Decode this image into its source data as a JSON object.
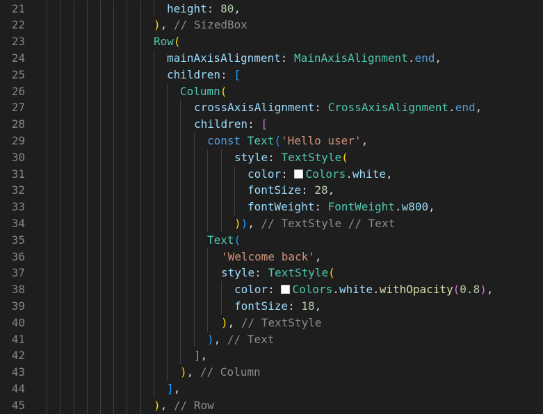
{
  "editor": {
    "line_numbers": [
      "21",
      "22",
      "23",
      "24",
      "25",
      "26",
      "27",
      "28",
      "29",
      "30",
      "31",
      "32",
      "33",
      "34",
      "35",
      "36",
      "37",
      "38",
      "39",
      "40",
      "41",
      "42",
      "43",
      "44",
      "45"
    ],
    "lines": [
      {
        "indent": 240,
        "tokens": [
          {
            "t": "height",
            "c": "prop"
          },
          {
            "t": ": ",
            "c": "p"
          },
          {
            "t": "80",
            "c": "num"
          },
          {
            "t": ",",
            "c": "p"
          }
        ]
      },
      {
        "indent": 221,
        "tokens": [
          {
            "t": ")",
            "c": "b3"
          },
          {
            "t": ", ",
            "c": "p"
          },
          {
            "t": "// SizedBox",
            "c": "cmt"
          }
        ]
      },
      {
        "indent": 221,
        "tokens": [
          {
            "t": "Row",
            "c": "cls"
          },
          {
            "t": "(",
            "c": "b3"
          }
        ]
      },
      {
        "indent": 240,
        "tokens": [
          {
            "t": "mainAxisAlignment",
            "c": "prop"
          },
          {
            "t": ": ",
            "c": "p"
          },
          {
            "t": "MainAxisAlignment",
            "c": "cls"
          },
          {
            "t": ".",
            "c": "p"
          },
          {
            "t": "end",
            "c": "kw"
          },
          {
            "t": ",",
            "c": "p"
          }
        ]
      },
      {
        "indent": 240,
        "tokens": [
          {
            "t": "children",
            "c": "prop"
          },
          {
            "t": ": ",
            "c": "p"
          },
          {
            "t": "[",
            "c": "b2"
          }
        ]
      },
      {
        "indent": 259,
        "tokens": [
          {
            "t": "Column",
            "c": "cls"
          },
          {
            "t": "(",
            "c": "b3"
          }
        ]
      },
      {
        "indent": 279,
        "tokens": [
          {
            "t": "crossAxisAlignment",
            "c": "prop"
          },
          {
            "t": ": ",
            "c": "p"
          },
          {
            "t": "CrossAxisAlignment",
            "c": "cls"
          },
          {
            "t": ".",
            "c": "p"
          },
          {
            "t": "end",
            "c": "kw"
          },
          {
            "t": ",",
            "c": "p"
          }
        ]
      },
      {
        "indent": 279,
        "tokens": [
          {
            "t": "children",
            "c": "prop"
          },
          {
            "t": ": ",
            "c": "p"
          },
          {
            "t": "[",
            "c": "b1"
          }
        ]
      },
      {
        "indent": 298,
        "tokens": [
          {
            "t": "const ",
            "c": "kw"
          },
          {
            "t": "Text",
            "c": "cls"
          },
          {
            "t": "(",
            "c": "b2"
          },
          {
            "t": "'Hello user'",
            "c": "str"
          },
          {
            "t": ",",
            "c": "p"
          }
        ]
      },
      {
        "indent": 337,
        "tokens": [
          {
            "t": "style",
            "c": "prop"
          },
          {
            "t": ": ",
            "c": "p"
          },
          {
            "t": "TextStyle",
            "c": "cls"
          },
          {
            "t": "(",
            "c": "b3"
          }
        ]
      },
      {
        "indent": 356,
        "tokens": [
          {
            "t": "color",
            "c": "prop"
          },
          {
            "t": ": ",
            "c": "p"
          },
          {
            "t": "",
            "c": "swatch"
          },
          {
            "t": "Colors",
            "c": "cls"
          },
          {
            "t": ".",
            "c": "p"
          },
          {
            "t": "white",
            "c": "prop"
          },
          {
            "t": ",",
            "c": "p"
          }
        ]
      },
      {
        "indent": 356,
        "tokens": [
          {
            "t": "fontSize",
            "c": "prop"
          },
          {
            "t": ": ",
            "c": "p"
          },
          {
            "t": "28",
            "c": "num"
          },
          {
            "t": ",",
            "c": "p"
          }
        ]
      },
      {
        "indent": 356,
        "tokens": [
          {
            "t": "fontWeight",
            "c": "prop"
          },
          {
            "t": ": ",
            "c": "p"
          },
          {
            "t": "FontWeight",
            "c": "cls"
          },
          {
            "t": ".",
            "c": "p"
          },
          {
            "t": "w800",
            "c": "prop"
          },
          {
            "t": ",",
            "c": "p"
          }
        ]
      },
      {
        "indent": 337,
        "tokens": [
          {
            "t": ")",
            "c": "b3"
          },
          {
            "t": ")",
            "c": "b2"
          },
          {
            "t": ", ",
            "c": "p"
          },
          {
            "t": "// TextStyle // Text",
            "c": "cmt"
          }
        ]
      },
      {
        "indent": 298,
        "tokens": [
          {
            "t": "Text",
            "c": "cls"
          },
          {
            "t": "(",
            "c": "b2"
          }
        ]
      },
      {
        "indent": 318,
        "tokens": [
          {
            "t": "'Welcome back'",
            "c": "str"
          },
          {
            "t": ",",
            "c": "p"
          }
        ]
      },
      {
        "indent": 318,
        "tokens": [
          {
            "t": "style",
            "c": "prop"
          },
          {
            "t": ": ",
            "c": "p"
          },
          {
            "t": "TextStyle",
            "c": "cls"
          },
          {
            "t": "(",
            "c": "b3"
          }
        ]
      },
      {
        "indent": 337,
        "tokens": [
          {
            "t": "color",
            "c": "prop"
          },
          {
            "t": ": ",
            "c": "p"
          },
          {
            "t": "",
            "c": "swatch"
          },
          {
            "t": "Colors",
            "c": "cls"
          },
          {
            "t": ".",
            "c": "p"
          },
          {
            "t": "white",
            "c": "prop"
          },
          {
            "t": ".",
            "c": "p"
          },
          {
            "t": "withOpacity",
            "c": "fn"
          },
          {
            "t": "(",
            "c": "b1"
          },
          {
            "t": "0.8",
            "c": "num"
          },
          {
            "t": ")",
            "c": "b1"
          },
          {
            "t": ",",
            "c": "p"
          }
        ]
      },
      {
        "indent": 337,
        "tokens": [
          {
            "t": "fontSize",
            "c": "prop"
          },
          {
            "t": ": ",
            "c": "p"
          },
          {
            "t": "18",
            "c": "num"
          },
          {
            "t": ",",
            "c": "p"
          }
        ]
      },
      {
        "indent": 318,
        "tokens": [
          {
            "t": ")",
            "c": "b3"
          },
          {
            "t": ", ",
            "c": "p"
          },
          {
            "t": "// TextStyle",
            "c": "cmt"
          }
        ]
      },
      {
        "indent": 298,
        "tokens": [
          {
            "t": ")",
            "c": "b2"
          },
          {
            "t": ", ",
            "c": "p"
          },
          {
            "t": "// Text",
            "c": "cmt"
          }
        ]
      },
      {
        "indent": 279,
        "tokens": [
          {
            "t": "]",
            "c": "b1"
          },
          {
            "t": ",",
            "c": "p"
          }
        ]
      },
      {
        "indent": 259,
        "tokens": [
          {
            "t": ")",
            "c": "b3"
          },
          {
            "t": ", ",
            "c": "p"
          },
          {
            "t": "// Column",
            "c": "cmt"
          }
        ]
      },
      {
        "indent": 240,
        "tokens": [
          {
            "t": "]",
            "c": "b2"
          },
          {
            "t": ",",
            "c": "p"
          }
        ]
      },
      {
        "indent": 221,
        "tokens": [
          {
            "t": ")",
            "c": "b3"
          },
          {
            "t": ", ",
            "c": "p"
          },
          {
            "t": "// Row",
            "c": "cmt"
          }
        ]
      }
    ]
  },
  "colors": {
    "background": "#1e1e1e",
    "line_number": "#858585",
    "indent_guide": "#404040"
  }
}
